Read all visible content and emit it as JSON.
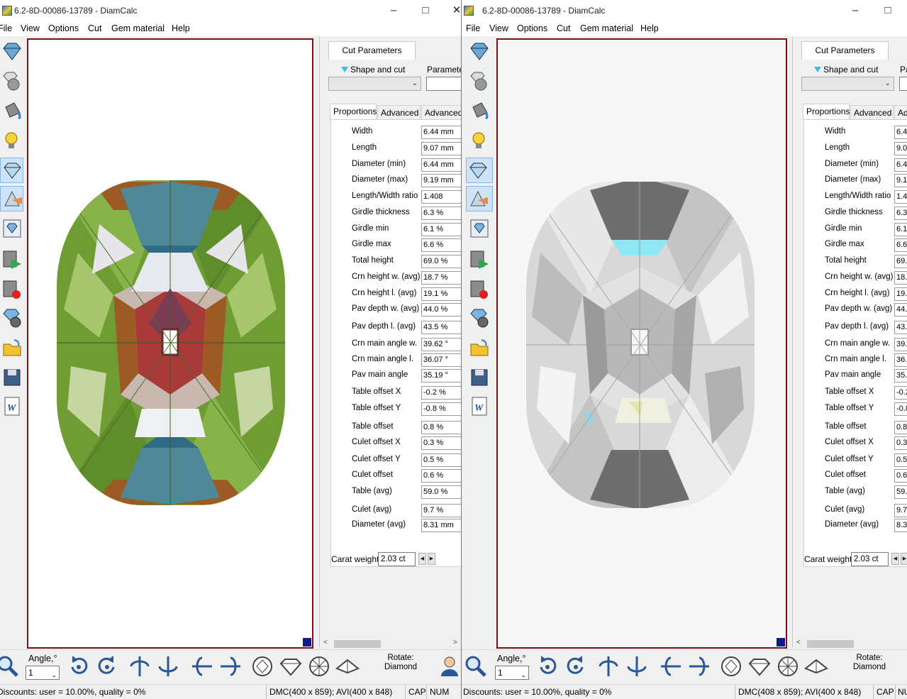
{
  "left_window": {
    "title": "6.2-8D-00086-13789 - DiamCalc",
    "controls": {
      "minimize": "–",
      "maximize": "□",
      "close": "✕"
    },
    "menu": [
      "File",
      "View",
      "Options",
      "Cut",
      "Gem material",
      "Help"
    ],
    "panel": {
      "tab": "Cut Parameters",
      "shape_label": "Shape and cut",
      "parameter_label": "Parameter",
      "subtabs": [
        "Proportions",
        "Advanced",
        "Advanced"
      ],
      "properties": [
        {
          "label": "Width",
          "value": "6.44 mm"
        },
        {
          "label": "Length",
          "value": "9.07 mm"
        },
        {
          "label": "Diameter (min)",
          "value": "6.44 mm"
        },
        {
          "label": "Diameter (max)",
          "value": "9.19 mm"
        },
        {
          "label": "Length/Width ratio",
          "value": "1.408"
        },
        {
          "label": "Girdle thickness",
          "value": "6.3 %"
        },
        {
          "label": "Girdle min",
          "value": "6.1 %"
        },
        {
          "label": "Girdle max",
          "value": "6.6 %"
        },
        {
          "label": "Total height",
          "value": "69.0 %"
        },
        {
          "label": "Crn height w. (avg)",
          "value": "18.7 %"
        },
        {
          "label": "Crn height l. (avg)",
          "value": "19.1 %"
        },
        {
          "label": "Pav depth w. (avg)",
          "value": "44.0 %"
        },
        {
          "label": "Pav depth l. (avg)",
          "value": "43.5 %"
        },
        {
          "label": "Crn main angle w.",
          "value": "39.62 °"
        },
        {
          "label": "Crn main angle l.",
          "value": "36.07 °"
        },
        {
          "label": "Pav main angle",
          "value": "35.19 °"
        },
        {
          "label": "Table offset X",
          "value": "-0.2 %"
        },
        {
          "label": "Table offset Y",
          "value": "-0.8 %"
        },
        {
          "label": "Table offset",
          "value": "0.8 %"
        },
        {
          "label": "Culet offset X",
          "value": "0.3 %"
        },
        {
          "label": "Culet offset Y",
          "value": "0.5 %"
        },
        {
          "label": "Culet offset",
          "value": "0.6 %"
        },
        {
          "label": "Table (avg)",
          "value": "59.0 %"
        },
        {
          "label": "Culet (avg)",
          "value": "9.7 %"
        },
        {
          "label": "Diameter (avg)",
          "value": "8.31 mm"
        }
      ],
      "carat_label": "Carat weight",
      "carat_value": "2.03 ct"
    },
    "bottom": {
      "angle_label": "Angle,°",
      "angle_value": "1",
      "rotate_label": "Rotate:",
      "rotate_value": "Diamond"
    },
    "status": {
      "discounts": "Discounts: user = 10.00%, quality = 0%",
      "dims": "DMC(400 x 859); AVI(400 x 848)",
      "cap": "CAP",
      "num": "NUM"
    }
  },
  "right_window": {
    "title": "6.2-8D-00086-13789 - DiamCalc",
    "controls": {
      "minimize": "–",
      "maximize": "□"
    },
    "menu": [
      "File",
      "View",
      "Options",
      "Cut",
      "Gem material",
      "Help"
    ],
    "panel": {
      "tab": "Cut Parameters",
      "shape_label": "Shape and cut",
      "parameter_label": "Pa",
      "subtabs": [
        "Proportions",
        "Advanced",
        "Adv"
      ],
      "properties": [
        {
          "label": "Width",
          "value": "6.4"
        },
        {
          "label": "Length",
          "value": "9.0"
        },
        {
          "label": "Diameter (min)",
          "value": "6.4"
        },
        {
          "label": "Diameter (max)",
          "value": "9.1"
        },
        {
          "label": "Length/Width ratio",
          "value": "1.4"
        },
        {
          "label": "Girdle thickness",
          "value": "6.3"
        },
        {
          "label": "Girdle min",
          "value": "6.1"
        },
        {
          "label": "Girdle max",
          "value": "6.6"
        },
        {
          "label": "Total height",
          "value": "69."
        },
        {
          "label": "Crn height w. (avg)",
          "value": "18."
        },
        {
          "label": "Crn height l. (avg)",
          "value": "19."
        },
        {
          "label": "Pav depth w. (avg)",
          "value": "44."
        },
        {
          "label": "Pav depth l. (avg)",
          "value": "43."
        },
        {
          "label": "Crn main angle w.",
          "value": "39."
        },
        {
          "label": "Crn main angle l.",
          "value": "36."
        },
        {
          "label": "Pav main angle",
          "value": "35."
        },
        {
          "label": "Table offset X",
          "value": "-0.2"
        },
        {
          "label": "Table offset Y",
          "value": "-0.8"
        },
        {
          "label": "Table offset",
          "value": "0.8"
        },
        {
          "label": "Culet offset X",
          "value": "0.3"
        },
        {
          "label": "Culet offset Y",
          "value": "0.5"
        },
        {
          "label": "Culet offset",
          "value": "0.6"
        },
        {
          "label": "Table (avg)",
          "value": "59."
        },
        {
          "label": "Culet (avg)",
          "value": "9.7"
        },
        {
          "label": "Diameter (avg)",
          "value": "8.3"
        }
      ],
      "carat_label": "Carat weight",
      "carat_value": "2.03 ct"
    },
    "bottom": {
      "angle_label": "Angle,°",
      "angle_value": "1",
      "rotate_label": "Rotate:",
      "rotate_value": "Diamond"
    },
    "status": {
      "discounts": "Discounts: user = 10.00%, quality = 0%",
      "dims": "DMC(408 x 859); AVI(400 x 848)",
      "cap": "CAP",
      "num": "NU"
    }
  },
  "colors": {
    "viewport_border": "#7a1111",
    "corner_marker": "#0b1b8a",
    "gem_mini_icon": "#36c0e6",
    "facet_green": "#6f9d34",
    "facet_brown": "#9c5a24",
    "facet_teal": "#4f8896",
    "facet_red": "#a83a3a"
  }
}
